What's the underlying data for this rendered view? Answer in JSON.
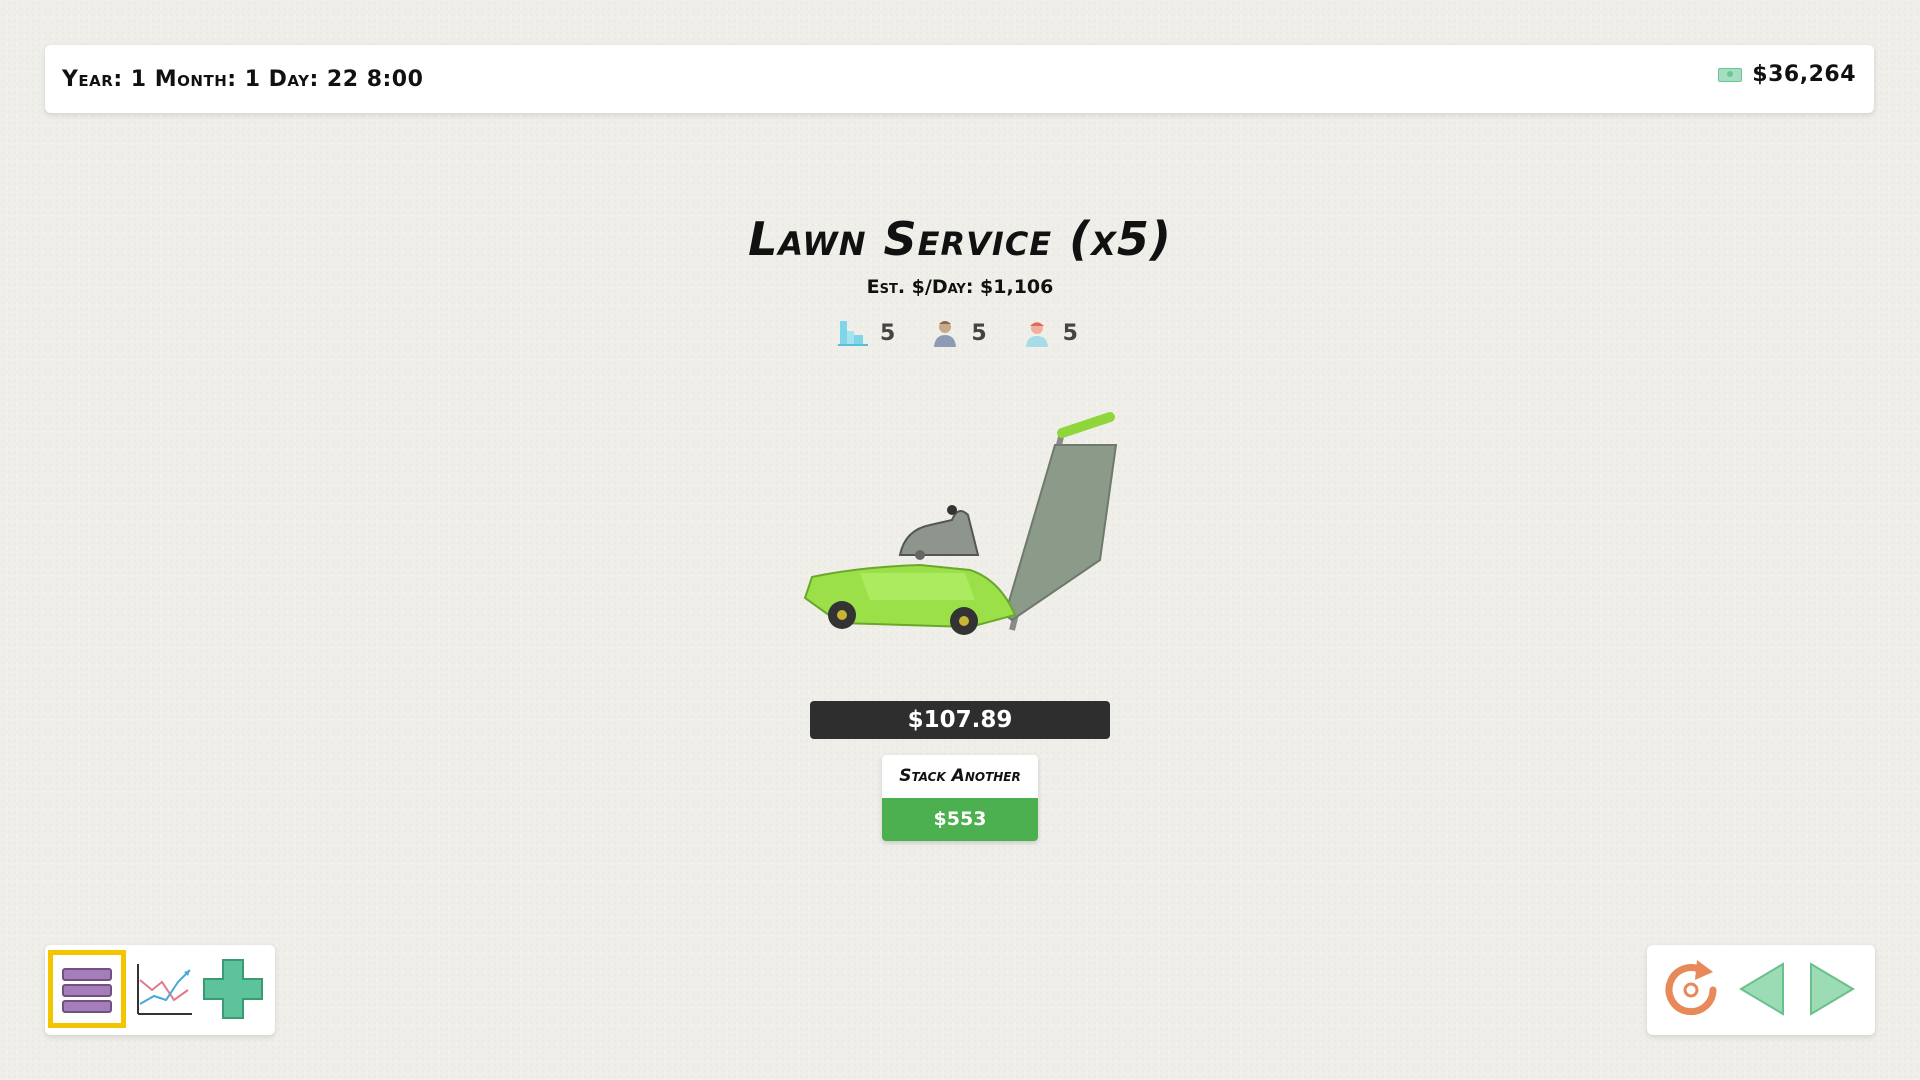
{
  "header": {
    "date_text": "Year: 1 Month: 1 Day: 22 8:00",
    "money_text": "$36,264",
    "money_icon": "cash-icon"
  },
  "business": {
    "title": "Lawn Service (x5)",
    "est_text": "Est. $/Day: $1,106",
    "stats": [
      {
        "icon": "buildings-icon",
        "value": "5"
      },
      {
        "icon": "worker-icon",
        "value": "5"
      },
      {
        "icon": "manager-icon",
        "value": "5"
      }
    ],
    "image": "lawn-mower-illustration",
    "price_text": "$107.89",
    "stack_label": "Stack Another",
    "stack_price": "$553"
  },
  "toolbar_left": [
    {
      "name": "menu-icon",
      "selected": true
    },
    {
      "name": "stats-chart-icon",
      "selected": false
    },
    {
      "name": "plus-icon",
      "selected": false
    }
  ],
  "toolbar_right": [
    {
      "name": "reset-icon"
    },
    {
      "name": "previous-arrow-icon"
    },
    {
      "name": "next-arrow-icon"
    }
  ],
  "colors": {
    "accent_green": "#4caf50",
    "price_bar": "#2e2e2e",
    "selection": "#f3c400",
    "background": "#efeee9"
  }
}
